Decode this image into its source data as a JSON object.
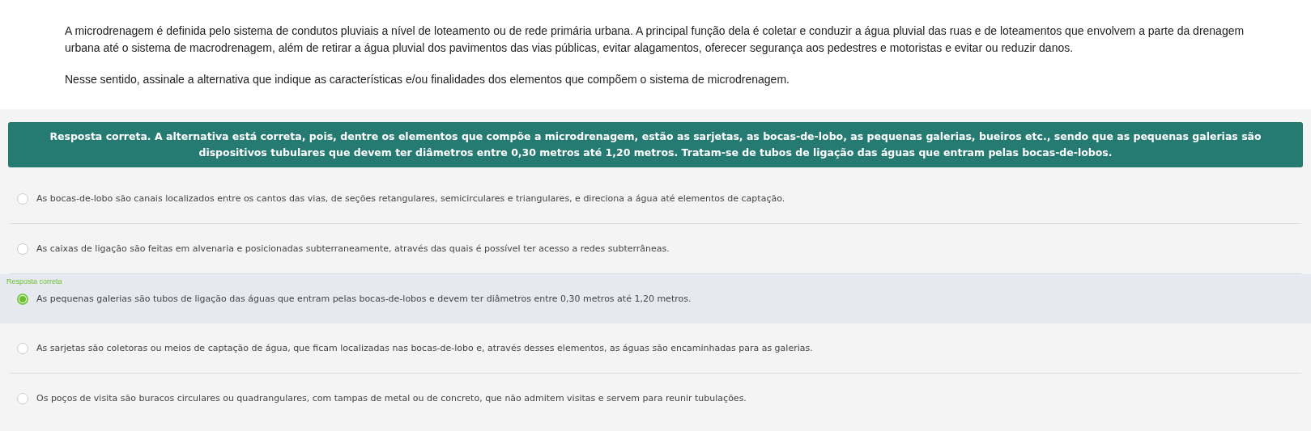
{
  "question": {
    "paragraphs": [
      "A microdrenagem é definida pelo sistema de condutos pluviais a nível de loteamento ou de rede primária urbana. A principal função dela é coletar e conduzir a água pluvial das ruas e de loteamentos que envolvem a parte da drenagem urbana até o sistema de macrodrenagem, além de retirar a água pluvial dos pavimentos das vias públicas, evitar alagamentos, oferecer segurança aos pedestres e motoristas e evitar ou reduzir danos.",
      "Nesse sentido, assinale a alternativa que indique as características e/ou finalidades dos elementos que compõem o sistema de microdrenagem."
    ]
  },
  "feedback": {
    "text": "Resposta correta. A alternativa está correta, pois, dentre os elementos que compõe a microdrenagem, estão as sarjetas, as bocas-de-lobo, as pequenas galerias, bueiros etc., sendo que as pequenas galerias são dispositivos tubulares que devem ter diâmetros entre 0,30 metros até 1,20 metros. Tratam-se de tubos de ligação das águas que entram pelas bocas-de-lobos."
  },
  "options": [
    {
      "text": "As bocas-de-lobo são canais localizados entre os cantos das vias, de seções retangulares, semicirculares e triangulares, e direciona a água até elementos de captação.",
      "selected": false
    },
    {
      "text": "As caixas de ligação são feitas em alvenaria e posicionadas subterraneamente, através das quais é possível ter acesso a redes subterrâneas.",
      "selected": false
    },
    {
      "text": "As pequenas galerias são tubos de ligação das águas que entram pelas bocas-de-lobos e devem ter diâmetros entre 0,30 metros até 1,20 metros.",
      "selected": true,
      "label": "Resposta correta"
    },
    {
      "text": "As sarjetas são coletoras ou meios de captação de água, que ficam localizadas nas bocas-de-lobo e, através desses elementos, as águas são encaminhadas para as galerias.",
      "selected": false
    },
    {
      "text": "Os poços de visita são buracos circulares ou quadrangulares, com tampas de metal ou de concreto, que não admitem visitas e servem para reunir tubulações.",
      "selected": false
    }
  ]
}
